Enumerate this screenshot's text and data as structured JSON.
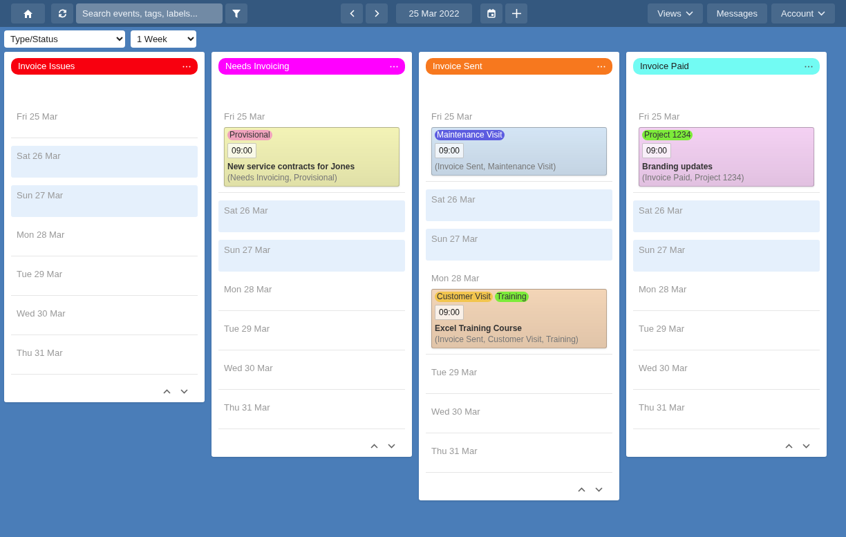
{
  "toolbar": {
    "search": {
      "placeholder": "Search events, tags, labels..."
    },
    "date": "25 Mar 2022",
    "menus": [
      {
        "label": "Views",
        "dropdown": true
      },
      {
        "label": "Messages",
        "dropdown": false
      },
      {
        "label": "Account",
        "dropdown": true
      }
    ]
  },
  "filters": {
    "group_by": "Type/Status",
    "range": "1 Week"
  },
  "columns": [
    {
      "title": "Invoice Issues",
      "color": "#f8000f",
      "days": [
        {
          "label": "Fri 25 Mar",
          "weekend": false
        },
        {
          "label": "Sat 26 Mar",
          "weekend": true
        },
        {
          "label": "Sun 27 Mar",
          "weekend": true
        },
        {
          "label": "Mon 28 Mar",
          "weekend": false
        },
        {
          "label": "Tue 29 Mar",
          "weekend": false
        },
        {
          "label": "Wed 30 Mar",
          "weekend": false
        },
        {
          "label": "Thu 31 Mar",
          "weekend": false
        }
      ]
    },
    {
      "title": "Needs Invoicing",
      "color": "#ff00ff",
      "days": [
        {
          "label": "Fri 25 Mar",
          "weekend": false,
          "events": [
            {
              "color": "#f3f3b6",
              "tags": [
                {
                  "label": "Provisional",
                  "color": "#f0a3bd"
                }
              ],
              "time": "09:00",
              "title": "New service contracts for Jones",
              "summary": "(Needs Invoicing, Provisional)"
            }
          ]
        },
        {
          "label": "Sat 26 Mar",
          "weekend": true
        },
        {
          "label": "Sun 27 Mar",
          "weekend": true
        },
        {
          "label": "Mon 28 Mar",
          "weekend": false
        },
        {
          "label": "Tue 29 Mar",
          "weekend": false
        },
        {
          "label": "Wed 30 Mar",
          "weekend": false
        },
        {
          "label": "Thu 31 Mar",
          "weekend": false
        }
      ]
    },
    {
      "title": "Invoice Sent",
      "color": "#f7781e",
      "days": [
        {
          "label": "Fri 25 Mar",
          "weekend": false,
          "events": [
            {
              "color": "#d4e5f5",
              "tags": [
                {
                  "label": "Maintenance Visit",
                  "color": "#5c5ce0"
                }
              ],
              "time": "09:00",
              "summary": "(Invoice Sent, Maintenance Visit)"
            }
          ]
        },
        {
          "label": "Sat 26 Mar",
          "weekend": true
        },
        {
          "label": "Sun 27 Mar",
          "weekend": true
        },
        {
          "label": "Mon 28 Mar",
          "weekend": false,
          "events": [
            {
              "color": "#f3d5b7",
              "tags": [
                {
                  "label": "Customer Visit",
                  "color": "#f2c54e"
                },
                {
                  "label": "Training",
                  "color": "#7deb3a"
                }
              ],
              "time": "09:00",
              "title": "Excel Training Course",
              "summary": "(Invoice Sent, Customer Visit, Training)"
            }
          ]
        },
        {
          "label": "Tue 29 Mar",
          "weekend": false
        },
        {
          "label": "Wed 30 Mar",
          "weekend": false
        },
        {
          "label": "Thu 31 Mar",
          "weekend": false
        }
      ]
    },
    {
      "title": "Invoice Paid",
      "color": "#72fbf3",
      "days": [
        {
          "label": "Fri 25 Mar",
          "weekend": false,
          "events": [
            {
              "color": "#f4d1f3",
              "tags": [
                {
                  "label": "Project 1234",
                  "color": "#7deb3a"
                }
              ],
              "time": "09:00",
              "title": "Branding updates",
              "summary": "(Invoice Paid, Project 1234)"
            }
          ]
        },
        {
          "label": "Sat 26 Mar",
          "weekend": true
        },
        {
          "label": "Sun 27 Mar",
          "weekend": true
        },
        {
          "label": "Mon 28 Mar",
          "weekend": false
        },
        {
          "label": "Tue 29 Mar",
          "weekend": false
        },
        {
          "label": "Wed 30 Mar",
          "weekend": false
        },
        {
          "label": "Thu 31 Mar",
          "weekend": false
        }
      ]
    }
  ]
}
